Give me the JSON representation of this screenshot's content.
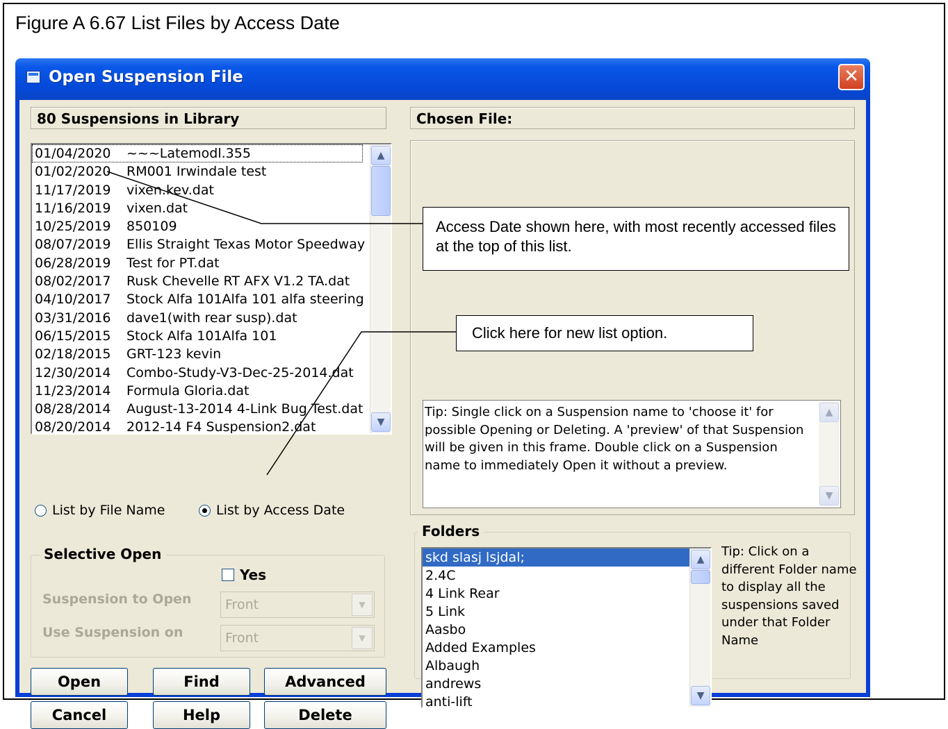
{
  "figure": {
    "caption": "Figure A 6.67  List Files by Access Date"
  },
  "window": {
    "title": "Open Suspension File",
    "close_glyph": "✕"
  },
  "library": {
    "count_label": "80 Suspensions in Library"
  },
  "chosen_file": {
    "label": "Chosen File:"
  },
  "files": [
    {
      "date": "01/04/2020",
      "name": "~~~Latemodl.355"
    },
    {
      "date": "01/02/2020",
      "name": "RM001 Irwindale test"
    },
    {
      "date": "11/17/2019",
      "name": "vixen.kev.dat"
    },
    {
      "date": "11/16/2019",
      "name": "vixen.dat"
    },
    {
      "date": "10/25/2019",
      "name": "850109"
    },
    {
      "date": "08/07/2019",
      "name": "Ellis Straight Texas Motor Speedway"
    },
    {
      "date": "06/28/2019",
      "name": "Test for PT.dat"
    },
    {
      "date": "08/02/2017",
      "name": "Rusk Chevelle RT AFX V1.2 TA.dat"
    },
    {
      "date": "04/10/2017",
      "name": "Stock Alfa 101Alfa 101 alfa steering"
    },
    {
      "date": "03/31/2016",
      "name": "dave1(with rear susp).dat"
    },
    {
      "date": "06/15/2015",
      "name": "Stock Alfa 101Alfa 101"
    },
    {
      "date": "02/18/2015",
      "name": "GRT-123 kevin"
    },
    {
      "date": "12/30/2014",
      "name": "Combo-Study-V3-Dec-25-2014.dat"
    },
    {
      "date": "11/23/2014",
      "name": "Formula Gloria.dat"
    },
    {
      "date": "08/28/2014",
      "name": "August-13-2014 4-Link Bug Test.dat"
    },
    {
      "date": "08/20/2014",
      "name": "2012-14 F4 Suspension2.dat"
    }
  ],
  "list_mode": {
    "by_name_label": "List by File Name",
    "by_date_label": "List by Access Date",
    "selected": "access_date"
  },
  "selective_open": {
    "title": "Selective Open",
    "yes_label": "Yes",
    "yes_checked": false,
    "suspension_to_open_label": "Suspension to Open",
    "suspension_to_open_value": "Front",
    "use_suspension_on_label": "Use Suspension on",
    "use_suspension_on_value": "Front"
  },
  "buttons": {
    "open": "Open",
    "find": "Find",
    "advanced": "Advanced",
    "cancel": "Cancel",
    "help": "Help",
    "delete": "Delete"
  },
  "callouts": {
    "access_date": "Access Date shown here, with most recently accessed files at the top of this list.",
    "new_list_option": "Click here for new list option."
  },
  "tip": {
    "text": "Tip: Single click on a Suspension name to 'choose it' for possible Opening or Deleting. A 'preview' of that Suspension will be given in this frame.  Double click on a Suspension name to immediately Open it without a preview."
  },
  "folders": {
    "title": "Folders",
    "items": [
      " skd slasj lsjdal;",
      "2.4C",
      "4 Link Rear",
      "5 Link",
      "Aasbo",
      "Added Examples",
      "Albaugh",
      "andrews",
      "anti-lift"
    ],
    "selected_index": 0,
    "tip": "Tip:  Click on a different Folder name to display all the suspensions saved under that Folder Name"
  },
  "icons": {
    "scroll_up": "chevron-up-icon",
    "scroll_down": "chevron-down-icon",
    "combo": "dropdown-arrow-icon",
    "title": "app-window-icon"
  },
  "colors": {
    "titlebar": "#0549d8",
    "client_bg": "#ece9d8",
    "selection": "#316ac5",
    "close_button": "#d04020"
  }
}
